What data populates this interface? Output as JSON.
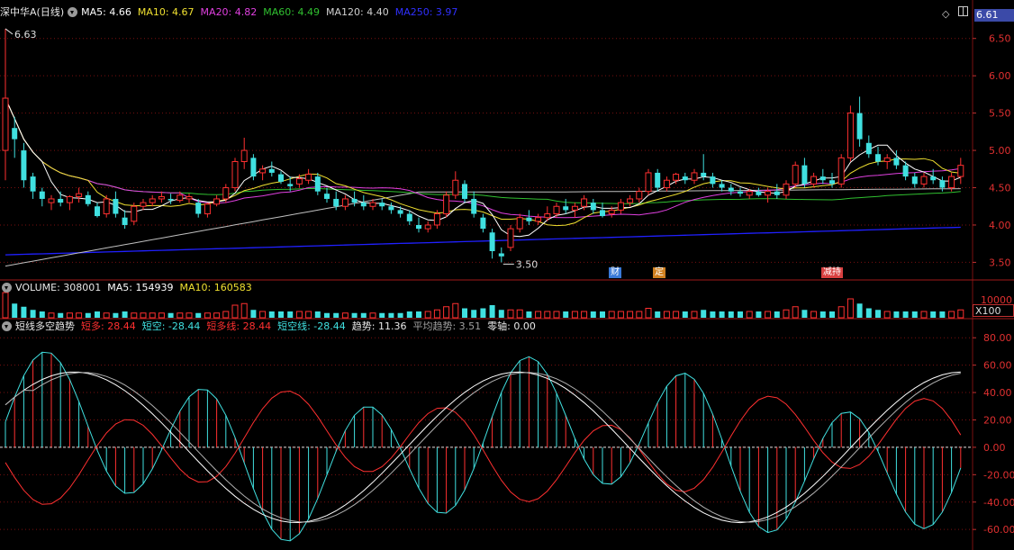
{
  "price_header": {
    "stock": "深中华A(日线)",
    "ma5": "MA5: 4.66",
    "ma10": "MA10: 4.67",
    "ma20": "MA20: 4.82",
    "ma60": "MA60: 4.49",
    "ma120": "MA120: 4.40",
    "ma250": "MA250: 3.97"
  },
  "volume_header": {
    "volume": "VOLUME: 308001",
    "ma5": "MA5: 154939",
    "ma10": "MA10: 160583"
  },
  "indicator_header": {
    "name": "短线多空趋势",
    "short_long": "短多: 28.44",
    "short_short": "短空: -28.44",
    "short_long_line": "短多线: 28.44",
    "short_short_line": "短空线: -28.44",
    "trend": "趋势: 11.36",
    "avg_trend": "平均趋势: 3.51",
    "zero_axis": "零轴: 0.00"
  },
  "current_price": "6.61",
  "volume_scale": "X100",
  "event_tags": [
    {
      "label": "财",
      "color": "#3a7ad8"
    },
    {
      "label": "定",
      "color": "#d08020"
    },
    {
      "label": "减持",
      "color": "#d84040"
    }
  ],
  "colors": {
    "up": "#ff3030",
    "down": "#40e0e0",
    "ma5": "#ffffff",
    "ma10": "#f0e030",
    "ma20": "#e040e0",
    "ma60": "#30c030",
    "ma120": "#c0c0c0",
    "ma250": "#2020ff",
    "grid": "#7a1010"
  },
  "chart_data": [
    {
      "type": "candlestick",
      "title": "深中华A(日线)",
      "ylim": [
        3.3,
        6.75
      ],
      "y_ticks": [
        "6.50",
        "6.00",
        "5.50",
        "5.00",
        "4.50",
        "4.00",
        "3.50"
      ],
      "high_label": "6.63",
      "low_label": "3.50",
      "ohlc": [
        [
          5.0,
          6.63,
          4.6,
          5.7
        ],
        [
          5.3,
          5.45,
          4.9,
          5.15
        ],
        [
          5.0,
          5.1,
          4.5,
          4.6
        ],
        [
          4.65,
          4.7,
          4.35,
          4.45
        ],
        [
          4.45,
          4.5,
          4.25,
          4.35
        ],
        [
          4.3,
          4.4,
          4.2,
          4.35
        ],
        [
          4.35,
          4.45,
          4.25,
          4.3
        ],
        [
          4.3,
          4.4,
          4.2,
          4.38
        ],
        [
          4.38,
          4.5,
          4.3,
          4.42
        ],
        [
          4.4,
          4.45,
          4.25,
          4.28
        ],
        [
          4.25,
          4.3,
          4.1,
          4.12
        ],
        [
          4.15,
          4.4,
          4.1,
          4.35
        ],
        [
          4.35,
          4.45,
          4.1,
          4.15
        ],
        [
          4.1,
          4.2,
          3.95,
          4.0
        ],
        [
          4.05,
          4.3,
          4.0,
          4.25
        ],
        [
          4.25,
          4.35,
          4.2,
          4.3
        ],
        [
          4.3,
          4.4,
          4.25,
          4.35
        ],
        [
          4.35,
          4.45,
          4.3,
          4.38
        ],
        [
          4.35,
          4.42,
          4.28,
          4.33
        ],
        [
          4.33,
          4.45,
          4.3,
          4.4
        ],
        [
          4.35,
          4.42,
          4.3,
          4.38
        ],
        [
          4.3,
          4.35,
          4.1,
          4.15
        ],
        [
          4.15,
          4.3,
          4.1,
          4.28
        ],
        [
          4.28,
          4.4,
          4.25,
          4.35
        ],
        [
          4.35,
          4.55,
          4.3,
          4.5
        ],
        [
          4.5,
          4.9,
          4.45,
          4.85
        ],
        [
          4.85,
          5.17,
          4.75,
          5.0
        ],
        [
          4.9,
          4.95,
          4.6,
          4.65
        ],
        [
          4.7,
          4.8,
          4.6,
          4.75
        ],
        [
          4.75,
          4.85,
          4.65,
          4.7
        ],
        [
          4.68,
          4.72,
          4.55,
          4.58
        ],
        [
          4.55,
          4.65,
          4.45,
          4.52
        ],
        [
          4.55,
          4.68,
          4.5,
          4.62
        ],
        [
          4.6,
          4.75,
          4.55,
          4.68
        ],
        [
          4.65,
          4.7,
          4.4,
          4.45
        ],
        [
          4.42,
          4.5,
          4.3,
          4.35
        ],
        [
          4.35,
          4.45,
          4.2,
          4.25
        ],
        [
          4.25,
          4.4,
          4.2,
          4.35
        ],
        [
          4.35,
          4.45,
          4.25,
          4.3
        ],
        [
          4.3,
          4.4,
          4.2,
          4.25
        ],
        [
          4.25,
          4.35,
          4.2,
          4.3
        ],
        [
          4.3,
          4.35,
          4.2,
          4.25
        ],
        [
          4.25,
          4.3,
          4.15,
          4.2
        ],
        [
          4.2,
          4.25,
          4.1,
          4.15
        ],
        [
          4.15,
          4.2,
          4.0,
          4.05
        ],
        [
          4.0,
          4.1,
          3.9,
          3.95
        ],
        [
          3.95,
          4.05,
          3.9,
          4.0
        ],
        [
          4.0,
          4.2,
          3.95,
          4.15
        ],
        [
          4.15,
          4.45,
          4.1,
          4.4
        ],
        [
          4.4,
          4.72,
          4.35,
          4.6
        ],
        [
          4.55,
          4.6,
          4.3,
          4.35
        ],
        [
          4.35,
          4.45,
          4.1,
          4.15
        ],
        [
          4.1,
          4.15,
          3.9,
          3.95
        ],
        [
          3.9,
          3.95,
          3.55,
          3.65
        ],
        [
          3.62,
          3.7,
          3.5,
          3.58
        ],
        [
          3.7,
          4.0,
          3.65,
          3.95
        ],
        [
          3.95,
          4.15,
          3.9,
          4.1
        ],
        [
          4.1,
          4.2,
          4.0,
          4.05
        ],
        [
          4.05,
          4.15,
          4.0,
          4.1
        ],
        [
          4.1,
          4.25,
          4.05,
          4.15
        ],
        [
          4.15,
          4.3,
          4.1,
          4.25
        ],
        [
          4.25,
          4.35,
          4.15,
          4.2
        ],
        [
          4.2,
          4.3,
          4.1,
          4.25
        ],
        [
          4.25,
          4.4,
          4.2,
          4.35
        ],
        [
          4.3,
          4.35,
          4.15,
          4.2
        ],
        [
          4.2,
          4.3,
          4.1,
          4.12
        ],
        [
          4.15,
          4.25,
          4.1,
          4.2
        ],
        [
          4.2,
          4.35,
          4.15,
          4.3
        ],
        [
          4.3,
          4.4,
          4.25,
          4.35
        ],
        [
          4.35,
          4.5,
          4.3,
          4.45
        ],
        [
          4.45,
          4.75,
          4.4,
          4.7
        ],
        [
          4.7,
          4.75,
          4.45,
          4.5
        ],
        [
          4.5,
          4.65,
          4.45,
          4.6
        ],
        [
          4.6,
          4.7,
          4.55,
          4.68
        ],
        [
          4.65,
          4.7,
          4.55,
          4.6
        ],
        [
          4.6,
          4.75,
          4.55,
          4.7
        ],
        [
          4.7,
          4.95,
          4.6,
          4.65
        ],
        [
          4.65,
          4.7,
          4.5,
          4.55
        ],
        [
          4.55,
          4.6,
          4.45,
          4.5
        ],
        [
          4.5,
          4.55,
          4.4,
          4.45
        ],
        [
          4.45,
          4.5,
          4.38,
          4.42
        ],
        [
          4.4,
          4.48,
          4.35,
          4.45
        ],
        [
          4.45,
          4.5,
          4.38,
          4.4
        ],
        [
          4.4,
          4.5,
          4.3,
          4.45
        ],
        [
          4.45,
          4.55,
          4.35,
          4.4
        ],
        [
          4.4,
          4.6,
          4.35,
          4.55
        ],
        [
          4.55,
          4.85,
          4.5,
          4.8
        ],
        [
          4.8,
          4.9,
          4.5,
          4.55
        ],
        [
          4.55,
          4.7,
          4.5,
          4.65
        ],
        [
          4.65,
          4.75,
          4.55,
          4.6
        ],
        [
          4.6,
          4.7,
          4.5,
          4.55
        ],
        [
          4.55,
          4.95,
          4.5,
          4.9
        ],
        [
          4.9,
          5.6,
          4.85,
          5.5
        ],
        [
          5.5,
          5.72,
          5.05,
          5.15
        ],
        [
          5.1,
          5.2,
          4.9,
          4.95
        ],
        [
          4.95,
          5.05,
          4.8,
          4.85
        ],
        [
          4.85,
          4.95,
          4.75,
          4.9
        ],
        [
          4.9,
          5.0,
          4.75,
          4.8
        ],
        [
          4.8,
          4.85,
          4.6,
          4.65
        ],
        [
          4.65,
          4.7,
          4.5,
          4.55
        ],
        [
          4.55,
          4.7,
          4.5,
          4.65
        ],
        [
          4.65,
          4.75,
          4.55,
          4.6
        ],
        [
          4.6,
          4.65,
          4.45,
          4.5
        ],
        [
          4.5,
          4.7,
          4.45,
          4.65
        ],
        [
          4.65,
          4.9,
          4.55,
          4.8
        ]
      ]
    },
    {
      "type": "bar",
      "title": "VOLUME",
      "ylabel": "10000",
      "values": [
        16,
        9,
        7,
        5,
        4,
        3,
        3,
        3,
        3,
        3,
        4,
        3,
        3,
        4,
        3,
        3,
        3,
        3,
        3,
        3,
        3,
        3,
        3,
        3,
        4,
        8,
        9,
        5,
        4,
        4,
        4,
        4,
        4,
        4,
        4,
        3,
        3,
        3,
        3,
        3,
        3,
        3,
        3,
        3,
        4,
        4,
        4,
        5,
        7,
        9,
        6,
        5,
        6,
        8,
        5,
        5,
        5,
        4,
        4,
        4,
        4,
        4,
        4,
        4,
        4,
        4,
        4,
        4,
        4,
        4,
        6,
        4,
        4,
        4,
        4,
        4,
        5,
        4,
        4,
        4,
        4,
        4,
        4,
        4,
        4,
        5,
        7,
        5,
        4,
        4,
        4,
        7,
        12,
        9,
        6,
        5,
        4,
        4,
        4,
        4,
        4,
        4,
        4,
        4,
        5
      ]
    },
    {
      "type": "bar",
      "title": "短线多空趋势",
      "ylim": [
        -75,
        90
      ],
      "y_ticks": [
        "80.00",
        "60.00",
        "40.00",
        "20.00",
        "0.00",
        "-20.00",
        "-40.00",
        "-60.00"
      ],
      "zero_line": 0
    }
  ]
}
